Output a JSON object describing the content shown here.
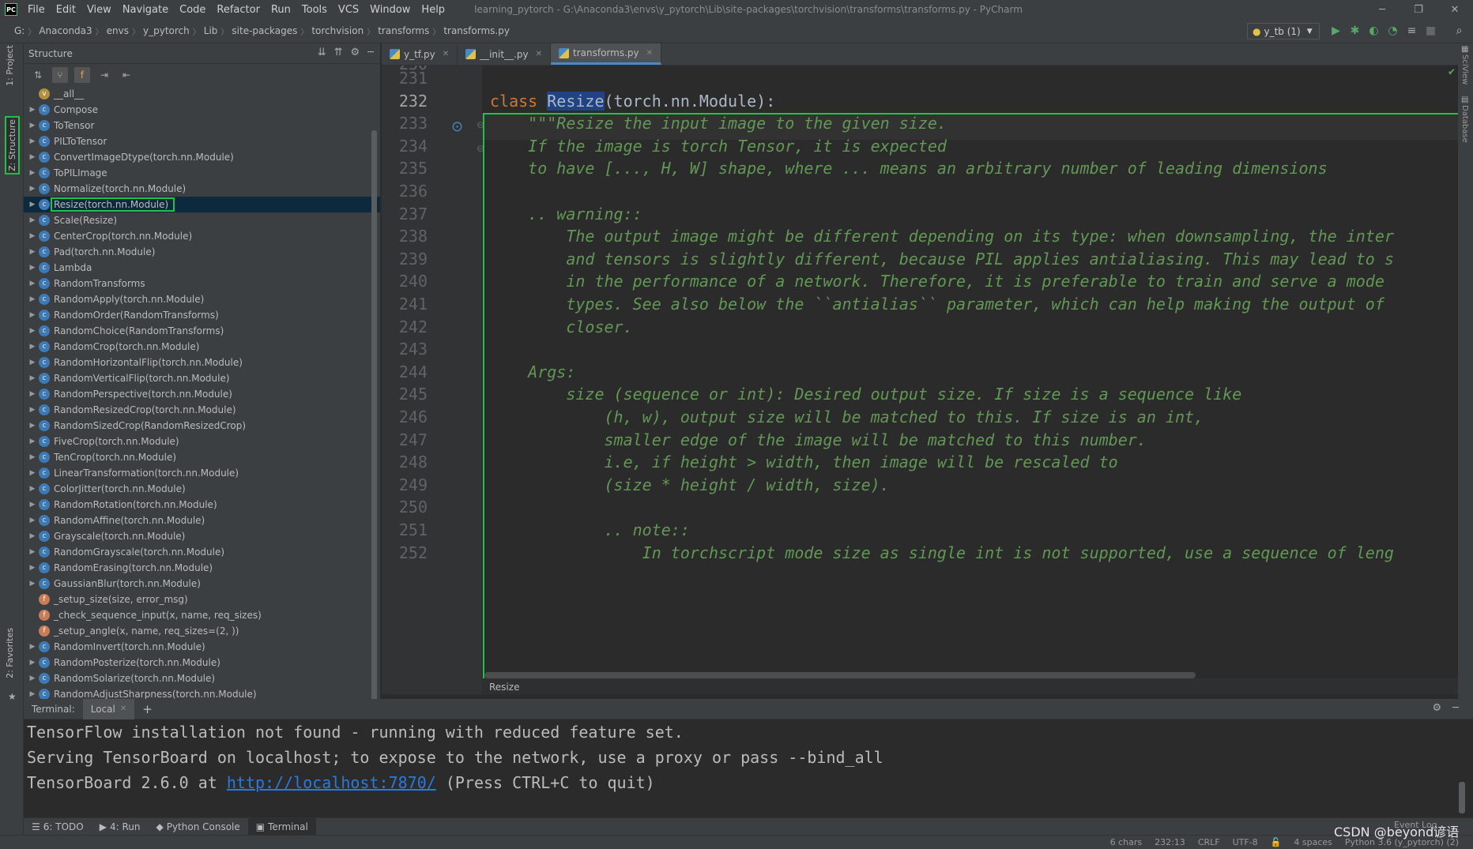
{
  "app": {
    "logo": "PC",
    "title": "learning_pytorch - G:\\Anaconda3\\envs\\y_pytorch\\Lib\\site-packages\\torchvision\\transforms\\transforms.py - PyCharm",
    "accent_color": "#21c14a",
    "selection_color": "#214283"
  },
  "menu": [
    "File",
    "Edit",
    "View",
    "Navigate",
    "Code",
    "Refactor",
    "Run",
    "Tools",
    "VCS",
    "Window",
    "Help"
  ],
  "navbar": {
    "crumbs": [
      "G:",
      "Anaconda3",
      "envs",
      "y_pytorch",
      "Lib",
      "site-packages",
      "torchvision",
      "transforms",
      "transforms.py"
    ],
    "run_config": "y_tb (1)"
  },
  "left_tabs": {
    "project": "1: Project",
    "structure": "Z: Structure",
    "favorites": "2: Favorites"
  },
  "structure": {
    "title": "Structure",
    "items": [
      {
        "label": "__all__",
        "kind": "v",
        "expandable": false
      },
      {
        "label": "Compose",
        "kind": "c",
        "expandable": true
      },
      {
        "label": "ToTensor",
        "kind": "c",
        "expandable": true
      },
      {
        "label": "PILToTensor",
        "kind": "c",
        "expandable": true
      },
      {
        "label": "ConvertImageDtype(torch.nn.Module)",
        "kind": "c",
        "expandable": true
      },
      {
        "label": "ToPILImage",
        "kind": "c",
        "expandable": true
      },
      {
        "label": "Normalize(torch.nn.Module)",
        "kind": "c",
        "expandable": true
      },
      {
        "label": "Resize(torch.nn.Module)",
        "kind": "c",
        "expandable": true,
        "selected": true
      },
      {
        "label": "Scale(Resize)",
        "kind": "c",
        "expandable": true
      },
      {
        "label": "CenterCrop(torch.nn.Module)",
        "kind": "c",
        "expandable": true
      },
      {
        "label": "Pad(torch.nn.Module)",
        "kind": "c",
        "expandable": true
      },
      {
        "label": "Lambda",
        "kind": "c",
        "expandable": true
      },
      {
        "label": "RandomTransforms",
        "kind": "c",
        "expandable": true
      },
      {
        "label": "RandomApply(torch.nn.Module)",
        "kind": "c",
        "expandable": true
      },
      {
        "label": "RandomOrder(RandomTransforms)",
        "kind": "c",
        "expandable": true
      },
      {
        "label": "RandomChoice(RandomTransforms)",
        "kind": "c",
        "expandable": true
      },
      {
        "label": "RandomCrop(torch.nn.Module)",
        "kind": "c",
        "expandable": true
      },
      {
        "label": "RandomHorizontalFlip(torch.nn.Module)",
        "kind": "c",
        "expandable": true
      },
      {
        "label": "RandomVerticalFlip(torch.nn.Module)",
        "kind": "c",
        "expandable": true
      },
      {
        "label": "RandomPerspective(torch.nn.Module)",
        "kind": "c",
        "expandable": true
      },
      {
        "label": "RandomResizedCrop(torch.nn.Module)",
        "kind": "c",
        "expandable": true
      },
      {
        "label": "RandomSizedCrop(RandomResizedCrop)",
        "kind": "c",
        "expandable": true
      },
      {
        "label": "FiveCrop(torch.nn.Module)",
        "kind": "c",
        "expandable": true
      },
      {
        "label": "TenCrop(torch.nn.Module)",
        "kind": "c",
        "expandable": true
      },
      {
        "label": "LinearTransformation(torch.nn.Module)",
        "kind": "c",
        "expandable": true
      },
      {
        "label": "ColorJitter(torch.nn.Module)",
        "kind": "c",
        "expandable": true
      },
      {
        "label": "RandomRotation(torch.nn.Module)",
        "kind": "c",
        "expandable": true
      },
      {
        "label": "RandomAffine(torch.nn.Module)",
        "kind": "c",
        "expandable": true
      },
      {
        "label": "Grayscale(torch.nn.Module)",
        "kind": "c",
        "expandable": true
      },
      {
        "label": "RandomGrayscale(torch.nn.Module)",
        "kind": "c",
        "expandable": true
      },
      {
        "label": "RandomErasing(torch.nn.Module)",
        "kind": "c",
        "expandable": true
      },
      {
        "label": "GaussianBlur(torch.nn.Module)",
        "kind": "c",
        "expandable": true
      },
      {
        "label": "_setup_size(size, error_msg)",
        "kind": "f",
        "expandable": false
      },
      {
        "label": "_check_sequence_input(x, name, req_sizes)",
        "kind": "f",
        "expandable": false
      },
      {
        "label": "_setup_angle(x, name, req_sizes=(2, ))",
        "kind": "f",
        "expandable": false
      },
      {
        "label": "RandomInvert(torch.nn.Module)",
        "kind": "c",
        "expandable": true
      },
      {
        "label": "RandomPosterize(torch.nn.Module)",
        "kind": "c",
        "expandable": true
      },
      {
        "label": "RandomSolarize(torch.nn.Module)",
        "kind": "c",
        "expandable": true
      },
      {
        "label": "RandomAdjustSharpness(torch.nn.Module)",
        "kind": "c",
        "expandable": true
      }
    ]
  },
  "tabs": [
    {
      "label": "y_tf.py",
      "active": false
    },
    {
      "label": "__init__.py",
      "active": false
    },
    {
      "label": "transforms.py",
      "active": true
    }
  ],
  "editor": {
    "first_partial_line": "230",
    "current_line": "232",
    "lines": [
      {
        "n": "231",
        "parts": [
          {
            "t": "",
            "c": ""
          }
        ]
      },
      {
        "n": "232",
        "parts": [
          {
            "t": "class ",
            "c": "kw"
          },
          {
            "t": "Resize",
            "c": "cls-name"
          },
          {
            "t": "(torch.nn.Module):",
            "c": ""
          }
        ]
      },
      {
        "n": "233",
        "parts": [
          {
            "t": "    \"\"\"Resize the input image to the given size.",
            "c": "doc"
          }
        ]
      },
      {
        "n": "234",
        "parts": [
          {
            "t": "    If the image is torch Tensor, it is expected",
            "c": "doc"
          }
        ]
      },
      {
        "n": "235",
        "parts": [
          {
            "t": "    to have [..., H, W] shape, where ... means an arbitrary number of leading dimensions",
            "c": "doc"
          }
        ]
      },
      {
        "n": "236",
        "parts": [
          {
            "t": "",
            "c": "doc"
          }
        ]
      },
      {
        "n": "237",
        "parts": [
          {
            "t": "    .. warning::",
            "c": "doc"
          }
        ]
      },
      {
        "n": "238",
        "parts": [
          {
            "t": "        The output image might be different depending on its type: when downsampling, the inter",
            "c": "doc"
          }
        ]
      },
      {
        "n": "239",
        "parts": [
          {
            "t": "        and tensors is slightly different, because PIL applies antialiasing. This may lead to s",
            "c": "doc"
          }
        ]
      },
      {
        "n": "240",
        "parts": [
          {
            "t": "        in the performance of a network. Therefore, it is preferable to train and serve a mode",
            "c": "doc"
          }
        ]
      },
      {
        "n": "241",
        "parts": [
          {
            "t": "        types. See also below the ``antialias`` parameter, which can help making the output of",
            "c": "doc"
          }
        ]
      },
      {
        "n": "242",
        "parts": [
          {
            "t": "        closer.",
            "c": "doc"
          }
        ]
      },
      {
        "n": "243",
        "parts": [
          {
            "t": "",
            "c": "doc"
          }
        ]
      },
      {
        "n": "244",
        "parts": [
          {
            "t": "    Args:",
            "c": "doc"
          }
        ]
      },
      {
        "n": "245",
        "parts": [
          {
            "t": "        size (sequence or int): Desired output size. If size is a sequence like",
            "c": "doc"
          }
        ]
      },
      {
        "n": "246",
        "parts": [
          {
            "t": "            (h, w), output size will be matched to this. If size is an int,",
            "c": "doc"
          }
        ]
      },
      {
        "n": "247",
        "parts": [
          {
            "t": "            smaller edge of the image will be matched to this number.",
            "c": "doc"
          }
        ]
      },
      {
        "n": "248",
        "parts": [
          {
            "t": "            i.e, if height > width, then image will be rescaled to",
            "c": "doc"
          }
        ]
      },
      {
        "n": "249",
        "parts": [
          {
            "t": "            (size * height / width, size).",
            "c": "doc"
          }
        ]
      },
      {
        "n": "250",
        "parts": [
          {
            "t": "",
            "c": "doc"
          }
        ]
      },
      {
        "n": "251",
        "parts": [
          {
            "t": "            .. note::",
            "c": "doc"
          }
        ]
      },
      {
        "n": "252",
        "parts": [
          {
            "t": "                In torchscript mode size as single int is not supported, use a sequence of leng",
            "c": "doc"
          }
        ]
      }
    ],
    "breadcrumb": "Resize"
  },
  "right_tabs": {
    "sciview": "SciView",
    "database": "Database"
  },
  "terminal": {
    "title": "Terminal:",
    "tab": "Local",
    "add": "+",
    "lines": [
      {
        "text": "TensorFlow installation not found - running with reduced feature set."
      },
      {
        "text": "Serving TensorBoard on localhost; to expose to the network, use a proxy or pass --bind_all"
      },
      {
        "pre": "TensorBoard 2.6.0 at ",
        "link": "http://localhost:7870/",
        "post": " (Press CTRL+C to quit)"
      }
    ]
  },
  "bottom_tools": [
    {
      "label": "6: TODO",
      "icon": "list-icon",
      "active": false
    },
    {
      "label": "4: Run",
      "icon": "play-icon",
      "active": false
    },
    {
      "label": "Python Console",
      "icon": "python-icon",
      "active": false
    },
    {
      "label": "Terminal",
      "icon": "terminal-icon",
      "active": true
    }
  ],
  "status": {
    "chars": "6 chars",
    "position": "232:13",
    "line_sep": "CRLF",
    "encoding": "UTF-8",
    "indent": "4 spaces",
    "interpreter": "Python 3.6 (y_pytorch) (2)",
    "event_log": "Event Log",
    "watermark": "CSDN @beyond谚语"
  }
}
